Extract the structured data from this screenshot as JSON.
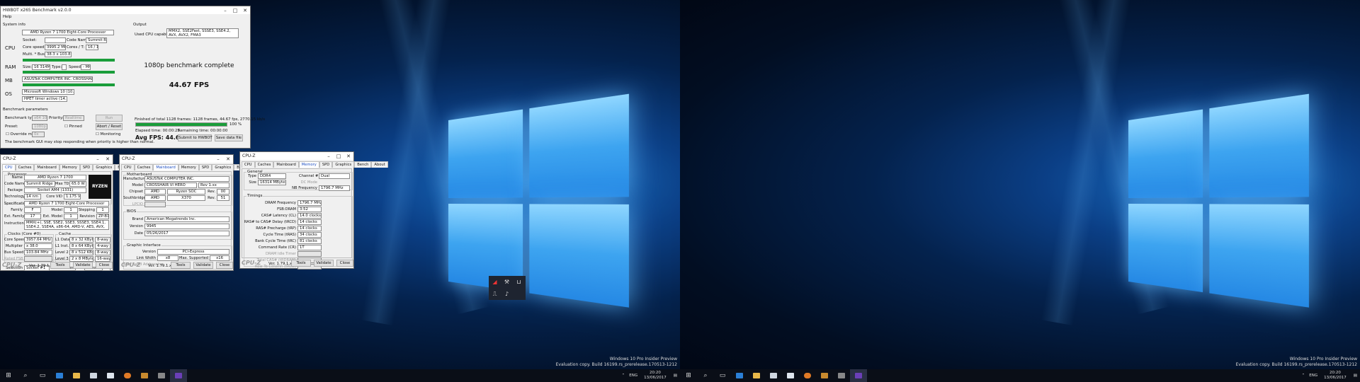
{
  "desktop_left": {
    "watermark_line1": "Windows 10 Pro Insider Preview",
    "watermark_line2": "Evaluation copy. Build 16199.rs_prerelease.170513-1212",
    "clock_time": "20:20",
    "clock_date": "13/06/2017",
    "lang": "ENG"
  },
  "desktop_right": {
    "watermark_line1": "Windows 10 Pro Insider Preview",
    "watermark_line2": "Evaluation copy. Build 16199.rs_prerelease.170513-1212",
    "clock_time": "20:20",
    "clock_date": "13/06/2017",
    "lang": "ENG"
  },
  "hwbot": {
    "title": "HWBOT x265 Benchmark v2.0.0",
    "menu_help": "Help",
    "system_info": "System info",
    "output": "Output",
    "cpu_label": "CPU",
    "ram_label": "RAM",
    "mb_label": "MB",
    "os_label": "OS",
    "cpu_name": "AMD Ryzen 7 1700 Eight-Core Processor",
    "socket_label": "Socket:",
    "code_name_label": "Code Name:",
    "code_name": "Summit Ridge",
    "core_speed_label": "Core speed:",
    "core_speed": "3995.2 MHz",
    "cores_label": "Cores / T:",
    "cores": "16 / 16",
    "multi_label": "Multi. * Bus:",
    "multi": "38.3 x 103.8 MHz",
    "size_label": "Size:",
    "ram_size": "16 314MB",
    "type_label": "Type:",
    "speed_label": "Speed:",
    "ram_speed": "- MHz",
    "mb_name": "ASUSTeK COMPUTER INC. CROSSHAIR VI HERO",
    "os_name": "Microsoft Windows 10 (10.0), 64-bit",
    "timer": "HPET timer active (14.318 MHz)",
    "used_caps_label": "Used CPU capabilities:",
    "used_caps": "MMX2, SSE2Fast, SSSE3, SSE4.2, AVX, AVX2, FMA3",
    "complete": "1080p benchmark complete",
    "fps_big": "44.67 FPS",
    "bench_params": "Benchmark parameters",
    "bench_type_label": "Benchmark type:",
    "bench_type": "x64 1080p",
    "priority_label": "Priority:",
    "priority": "Realtime",
    "run": "Run",
    "preset_label": "Preset:",
    "preset": "1080p",
    "pinned": "Pinned",
    "abort": "Abort / Reset",
    "override_label": "Override mode",
    "override_value": "0x",
    "monitoring": "Monitoring",
    "finished": "Finished of total 1128 frames: 1128 frames, 44.67 fps, 2770.15 kb/s",
    "percent": "100 %",
    "elapsed": "Elapsed time: 00:00:25",
    "remaining": "Remaining time: 00:00:00",
    "avg": "Avg FPS: 44.67",
    "submit": "Submit to HWBOT",
    "save": "Save data file",
    "note": "The benchmark GUI may stop responding when priority is higher than normal.",
    "progress": 1.0
  },
  "cpuz_common": {
    "title": "CPU-Z",
    "brand": "CPU-Z",
    "version": "Ver. 1.79.1.x64",
    "tools": "Tools",
    "validate": "Validate",
    "close": "Close",
    "tabs": [
      "CPU",
      "Caches",
      "Mainboard",
      "Memory",
      "SPD",
      "Graphics",
      "Bench",
      "About"
    ]
  },
  "cpuz_cpu": {
    "processor": "Processor",
    "name_label": "Name",
    "name": "AMD Ryzen 7 1700",
    "code_label": "Code Name",
    "code": "Summit Ridge",
    "tdp_label": "Max TDP",
    "tdp": "65.0 W",
    "package_label": "Package",
    "package": "Socket AM4 (1331)",
    "tech_label": "Technology",
    "tech": "14 nm",
    "voltage_label": "Core VID",
    "voltage": "1.175 V",
    "spec_label": "Specification",
    "spec": "AMD Ryzen 7 1700 Eight-Core Processor",
    "family_label": "Family",
    "family": "F",
    "model_label": "Model",
    "model": "1",
    "stepping_label": "Stepping",
    "stepping": "1",
    "ext_family_label": "Ext. Family",
    "ext_family": "17",
    "ext_model_label": "Ext. Model",
    "ext_model": "1",
    "revision_label": "Revision",
    "revision": "ZP-B1",
    "instr_label": "Instructions",
    "instr": "MMX(+), SSE, SSE2, SSE3, SSSE3, SSE4.1, SSE4.2, SSE4A, x86-64, AMD-V, AES, AVX, AVX2, FMA3, SHA",
    "clocks": "Clocks (Core #0)",
    "cache": "Cache",
    "core_speed_label": "Core Speed",
    "core_speed": "3957.64 MHz",
    "multi_label": "Multiplier",
    "multi": "x 38.0",
    "bus_label": "Bus Speed",
    "bus": "103.84 MHz",
    "fsb_label": "Rated FSB",
    "l1d_label": "L1 Data",
    "l1d": "8 x 32 KBytes",
    "l1d_w": "8-way",
    "l1i_label": "L1 Inst.",
    "l1i": "8 x 64 KBytes",
    "l1i_w": "4-way",
    "l2_label": "Level 2",
    "l2": "8 x 512 KBytes",
    "l2_w": "8-way",
    "l3_label": "Level 3",
    "l3": "2 x 8 MBytes",
    "l3_w": "16-way",
    "selection_label": "Selection",
    "selection": "Socket #1",
    "cores_label": "Cores",
    "cores": "8",
    "threads_label": "Threads",
    "threads": "16",
    "ryzen_logo": "RYZEN"
  },
  "cpuz_mb": {
    "motherboard": "Motherboard",
    "manu_label": "Manufacturer",
    "manu": "ASUSTeK COMPUTER INC.",
    "model_label": "Model",
    "model": "CROSSHAIR VI HERO",
    "rev": "Rev 1.xx",
    "chipset_label": "Chipset",
    "chipset": "AMD",
    "chipset2": "Ryzen SOC",
    "chip_rev_label": "Rev.",
    "chip_rev": "00",
    "south_label": "Southbridge",
    "south": "AMD",
    "south2": "X370",
    "south_rev": "51",
    "lpcio_label": "LPCIO",
    "bios": "BIOS",
    "brand_label": "Brand",
    "brand": "American Megatrends Inc.",
    "version_label": "Version",
    "version": "9945",
    "date_label": "Date",
    "date": "05/26/2017",
    "gi": "Graphic Interface",
    "gi_version_label": "Version",
    "gi_version": "PCI-Express",
    "lw_label": "Link Width",
    "lw": "x8",
    "max_label": "Max. Supported",
    "max": "x16",
    "side_band": "Side Band Addressing"
  },
  "cpuz_mem": {
    "general": "General",
    "type_label": "Type",
    "type": "DDR4",
    "channel_label": "Channel #",
    "channel": "Dual",
    "size_label": "Size",
    "size": "16314 MBytes",
    "dc_label": "DC Mode",
    "nb_label": "NB Frequency",
    "nb": "1796.7 MHz",
    "timings": "Timings",
    "rows": [
      {
        "label": "DRAM Frequency",
        "value": "1796.7 MHz"
      },
      {
        "label": "FSB:DRAM",
        "value": "3:52"
      },
      {
        "label": "CAS# Latency (CL)",
        "value": "14.0 clocks"
      },
      {
        "label": "RAS# to CAS# Delay (tRCD)",
        "value": "14 clocks"
      },
      {
        "label": "RAS# Precharge (tRP)",
        "value": "14 clocks"
      },
      {
        "label": "Cycle Time (tRAS)",
        "value": "34 clocks"
      },
      {
        "label": "Bank Cycle Time (tRC)",
        "value": "81 clocks"
      },
      {
        "label": "Command Rate (CR)",
        "value": "1T"
      },
      {
        "label": "DRAM Idle Timer",
        "value": ""
      },
      {
        "label": "Total CAS# (tRDRAM)",
        "value": ""
      },
      {
        "label": "Row To Column (tRCD)",
        "value": ""
      }
    ]
  }
}
